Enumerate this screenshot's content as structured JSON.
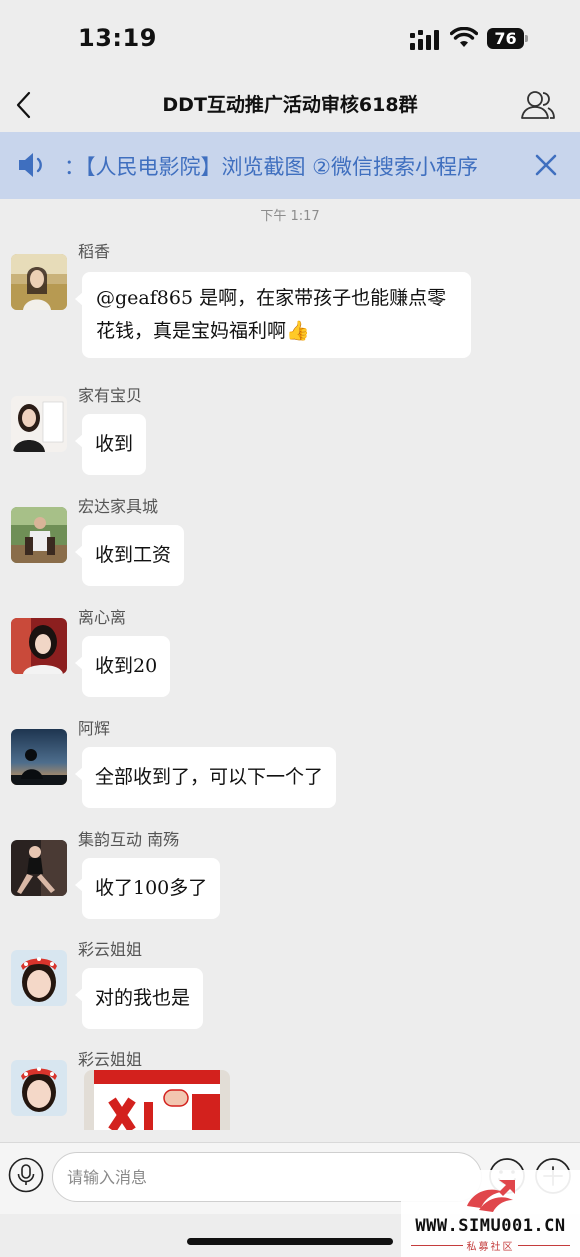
{
  "status_bar": {
    "time": "13:19",
    "battery": "76"
  },
  "nav": {
    "title": "DDT互动推广活动审核618群"
  },
  "announcement": {
    "text": "：【人民电影院】浏览截图 ②微信搜索小程序"
  },
  "timestamp": "下午 1:17",
  "messages": [
    {
      "sender": "稻香",
      "text": "@geaf865 是啊，在家带孩子也能赚点零花钱，真是宝妈福利啊👍"
    },
    {
      "sender": "家有宝贝",
      "text": "收到"
    },
    {
      "sender": "宏达家具城",
      "text": "收到工资"
    },
    {
      "sender": "离心离",
      "text": "收到20"
    },
    {
      "sender": "阿辉",
      "text": "全部收到了，可以下一个了"
    },
    {
      "sender": "集韵互动 南殇",
      "text": "收了100多了"
    },
    {
      "sender": "彩云姐姐",
      "text": "对的我也是"
    },
    {
      "sender": "彩云姐姐",
      "text": ""
    }
  ],
  "input": {
    "placeholder": "请输入消息"
  },
  "watermark": {
    "site": "WWW.SIMU001.CN",
    "sub": "私募社区"
  },
  "colors": {
    "background": "#ededed",
    "announce_bg": "#c8d5ec",
    "announce_text": "#3f6fbf",
    "bubble": "#ffffff"
  },
  "icons": [
    "back-icon",
    "members-icon",
    "speaker-icon",
    "close-icon",
    "voice-icon",
    "emoji-icon",
    "plus-icon"
  ]
}
